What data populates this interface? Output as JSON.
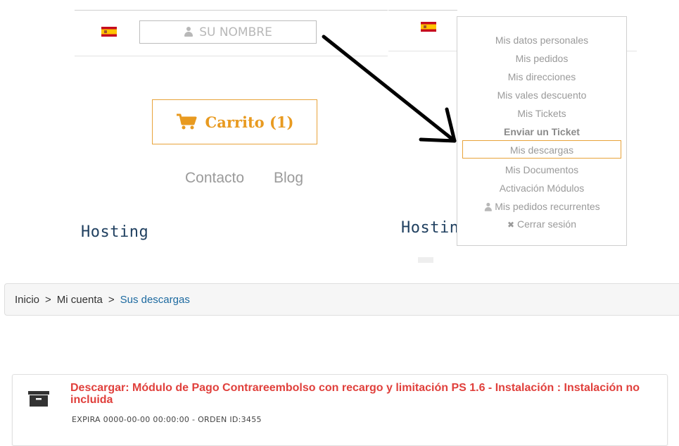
{
  "left_header": {
    "name_field": {
      "value": "SU NOMBRE",
      "icon": "user-icon"
    },
    "cart_button": {
      "label": "Carrito (1)",
      "icon": "cart-icon"
    },
    "nav_links": [
      "Contacto",
      "Blog"
    ],
    "hosting_label": "Hosting"
  },
  "right_header": {
    "hosting_label_partial": "Hostin"
  },
  "account_menu": {
    "items": [
      {
        "label": "Mis datos personales"
      },
      {
        "label": "Mis pedidos"
      },
      {
        "label": "Mis direcciones"
      },
      {
        "label": "Mis vales descuento"
      },
      {
        "label": "Mis Tickets"
      },
      {
        "label": "Enviar un Ticket"
      },
      {
        "label": "Mis descargas"
      },
      {
        "label": "Mis Documentos"
      },
      {
        "label": "Activación Módulos"
      },
      {
        "label": "Mis pedidos recurrentes",
        "icon": "user-icon"
      },
      {
        "label": "Cerrar sesión",
        "icon": "close-icon"
      }
    ]
  },
  "breadcrumb": {
    "items": [
      "Inicio",
      "Mi cuenta",
      "Sus descargas"
    ],
    "separator": ">"
  },
  "download": {
    "title": "Descargar: Módulo de Pago Contrareembolso con recargo y limitación PS 1.6 - Instalación : Instalación no incluida",
    "meta": "EXPIRA 0000-00-00 00:00:00 - ORDEN ID:3455",
    "icon": "archive-icon"
  },
  "colors": {
    "accent_orange": "#e89a20",
    "title_red": "#e0403c",
    "hosting_blue": "#1f3f5f",
    "link_blue": "#1d6aa0"
  }
}
